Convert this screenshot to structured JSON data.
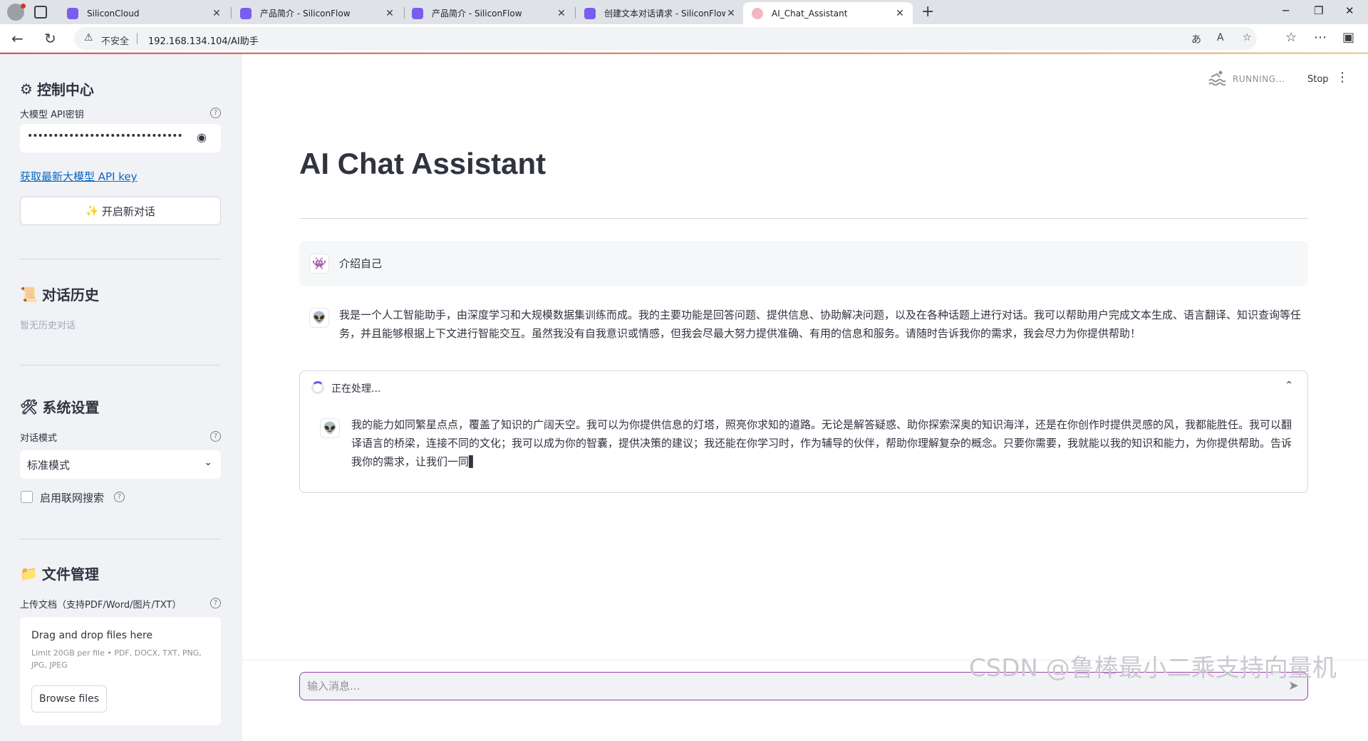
{
  "browser": {
    "tabs": [
      {
        "title": "SiliconCloud"
      },
      {
        "title": "产品简介 - SiliconFlow"
      },
      {
        "title": "产品简介 - SiliconFlow"
      },
      {
        "title": "创建文本对话请求 - SiliconFlow"
      },
      {
        "title": "AI_Chat_Assistant"
      }
    ],
    "insecure_label": "不安全",
    "url": "192.168.134.104/AI助手"
  },
  "sidebar": {
    "control_center": {
      "title": "控制中心",
      "api_key_label": "大模型 API密钥",
      "api_key_value": "•••••••••••••••••••••••••••••••••••••••••••••••••",
      "api_link": "获取最新大模型 API key",
      "new_chat_label": "开启新对话"
    },
    "history": {
      "title": "对话历史",
      "empty": "暂无历史对话"
    },
    "settings": {
      "title": "系统设置",
      "mode_label": "对话模式",
      "mode_value": "标准模式",
      "web_search_label": "启用联网搜索"
    },
    "files": {
      "title": "文件管理",
      "upload_label": "上传文档（支持PDF/Word/图片/TXT）",
      "drop_title": "Drag and drop files here",
      "limit": "Limit 20GB per file • PDF, DOCX, TXT, PNG, JPG, JPEG",
      "browse": "Browse files"
    }
  },
  "main": {
    "status": "RUNNING...",
    "stop": "Stop",
    "title": "AI Chat Assistant",
    "messages": [
      {
        "role": "user",
        "text": "介绍自己"
      },
      {
        "role": "assistant",
        "text": "我是一个人工智能助手，由深度学习和大规模数据集训练而成。我的主要功能是回答问题、提供信息、协助解决问题，以及在各种话题上进行对话。我可以帮助用户完成文本生成、语言翻译、知识查询等任务，并且能够根据上下文进行智能交互。虽然我没有自我意识或情感，但我会尽最大努力提供准确、有用的信息和服务。请随时告诉我你的需求，我会尽力为你提供帮助！"
      }
    ],
    "processing": {
      "label": "正在处理...",
      "text": "我的能力如同繁星点点，覆盖了知识的广阔天空。我可以为你提供信息的灯塔，照亮你求知的道路。无论是解答疑惑、助你探索深奥的知识海洋，还是在你创作时提供灵感的风，我都能胜任。我可以翻译语言的桥梁，连接不同的文化；我可以成为你的智囊，提供决策的建议；我还能在你学习时，作为辅导的伙伴，帮助你理解复杂的概念。只要你需要，我就能以我的知识和能力，为你提供帮助。告诉我你的需求，让我们一同▌"
    },
    "input_placeholder": "输入消息...",
    "watermark": "CSDN @鲁棒最小二乘支持向量机"
  }
}
